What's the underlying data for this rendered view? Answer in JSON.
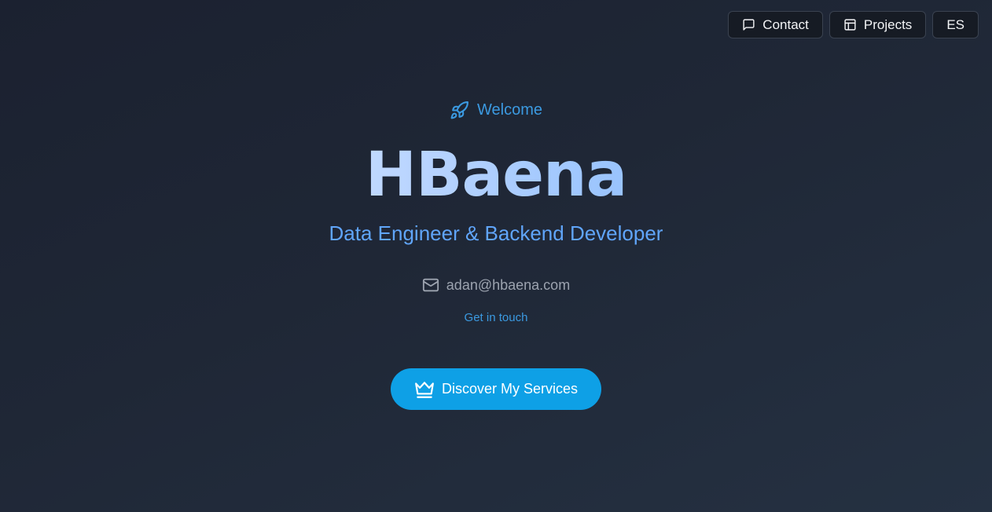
{
  "nav": {
    "contact_label": "Contact",
    "projects_label": "Projects",
    "language_label": "ES"
  },
  "hero": {
    "welcome_label": "Welcome",
    "brand": "HBaena",
    "subtitle": "Data Engineer & Backend Developer",
    "email": "adan@hbaena.com",
    "get_in_touch": "Get in touch",
    "cta_label": "Discover My Services"
  },
  "icons": {
    "contact": "message-square-icon",
    "projects": "layout-icon",
    "welcome": "rocket-icon",
    "email": "mail-icon",
    "cta": "crown-icon"
  },
  "colors": {
    "accent": "#0ea0e6",
    "link": "#3b9ae1",
    "subtitle": "#60a5fa",
    "background": "#1f2736"
  }
}
